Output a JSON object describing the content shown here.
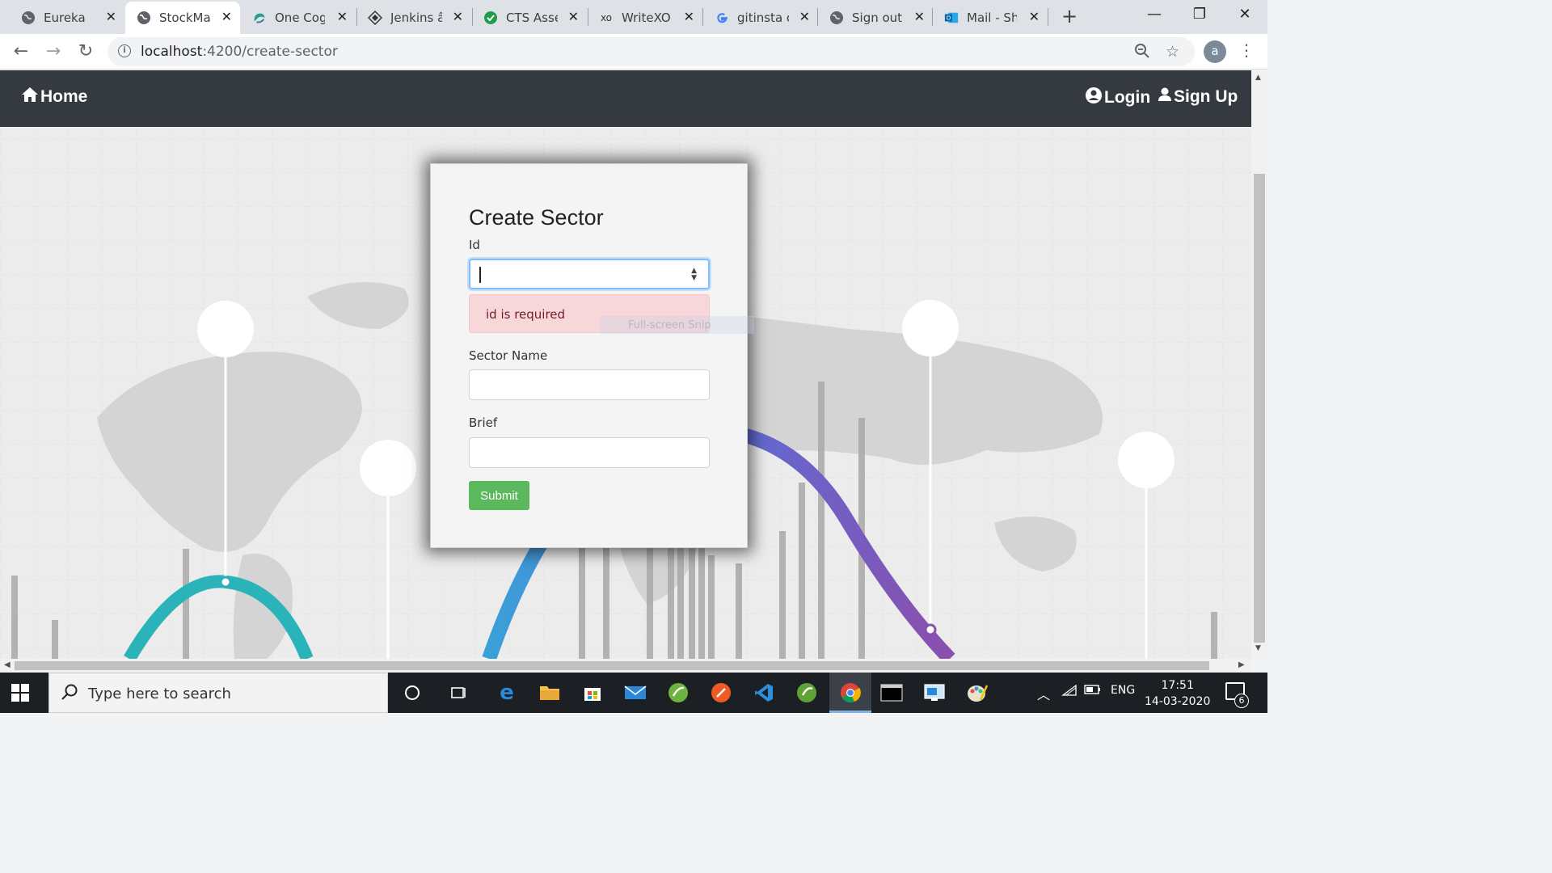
{
  "browser": {
    "tabs": [
      {
        "label": "Eureka",
        "icon": "globe-icon"
      },
      {
        "label": "StockMarket",
        "icon": "globe-icon",
        "active": true
      },
      {
        "label": "One Cognizant",
        "icon": "cognizant-icon"
      },
      {
        "label": "Jenkins â€",
        "icon": "jenkins-icon"
      },
      {
        "label": "CTS Assessment",
        "icon": "check-icon"
      },
      {
        "label": "WriteXO",
        "icon": "xo-icon"
      },
      {
        "label": "gitinsta co",
        "icon": "google-icon"
      },
      {
        "label": "Sign out",
        "icon": "globe-icon"
      },
      {
        "label": "Mail - Shi",
        "icon": "outlook-icon"
      }
    ],
    "url_host": "localhost",
    "url_rest": ":4200/create-sector",
    "profile_initial": "a"
  },
  "app": {
    "nav": {
      "home_label": "Home",
      "login_label": "Login",
      "signup_label": "Sign Up"
    },
    "form": {
      "title": "Create Sector",
      "id_label": "Id",
      "id_value": "",
      "id_error": "id is required",
      "sector_name_label": "Sector Name",
      "sector_name_value": "",
      "brief_label": "Brief",
      "brief_value": "",
      "submit_label": "Submit"
    },
    "overlay_text": "Full-screen Snip"
  },
  "taskbar": {
    "search_placeholder": "Type here to search",
    "language": "ENG",
    "time": "17:51",
    "date": "14-03-2020",
    "notification_count": "6"
  },
  "colors": {
    "navbar": "#343a40",
    "submit": "#5cb85c",
    "alert_bg": "#f8d7da",
    "alert_text": "#721c24"
  }
}
